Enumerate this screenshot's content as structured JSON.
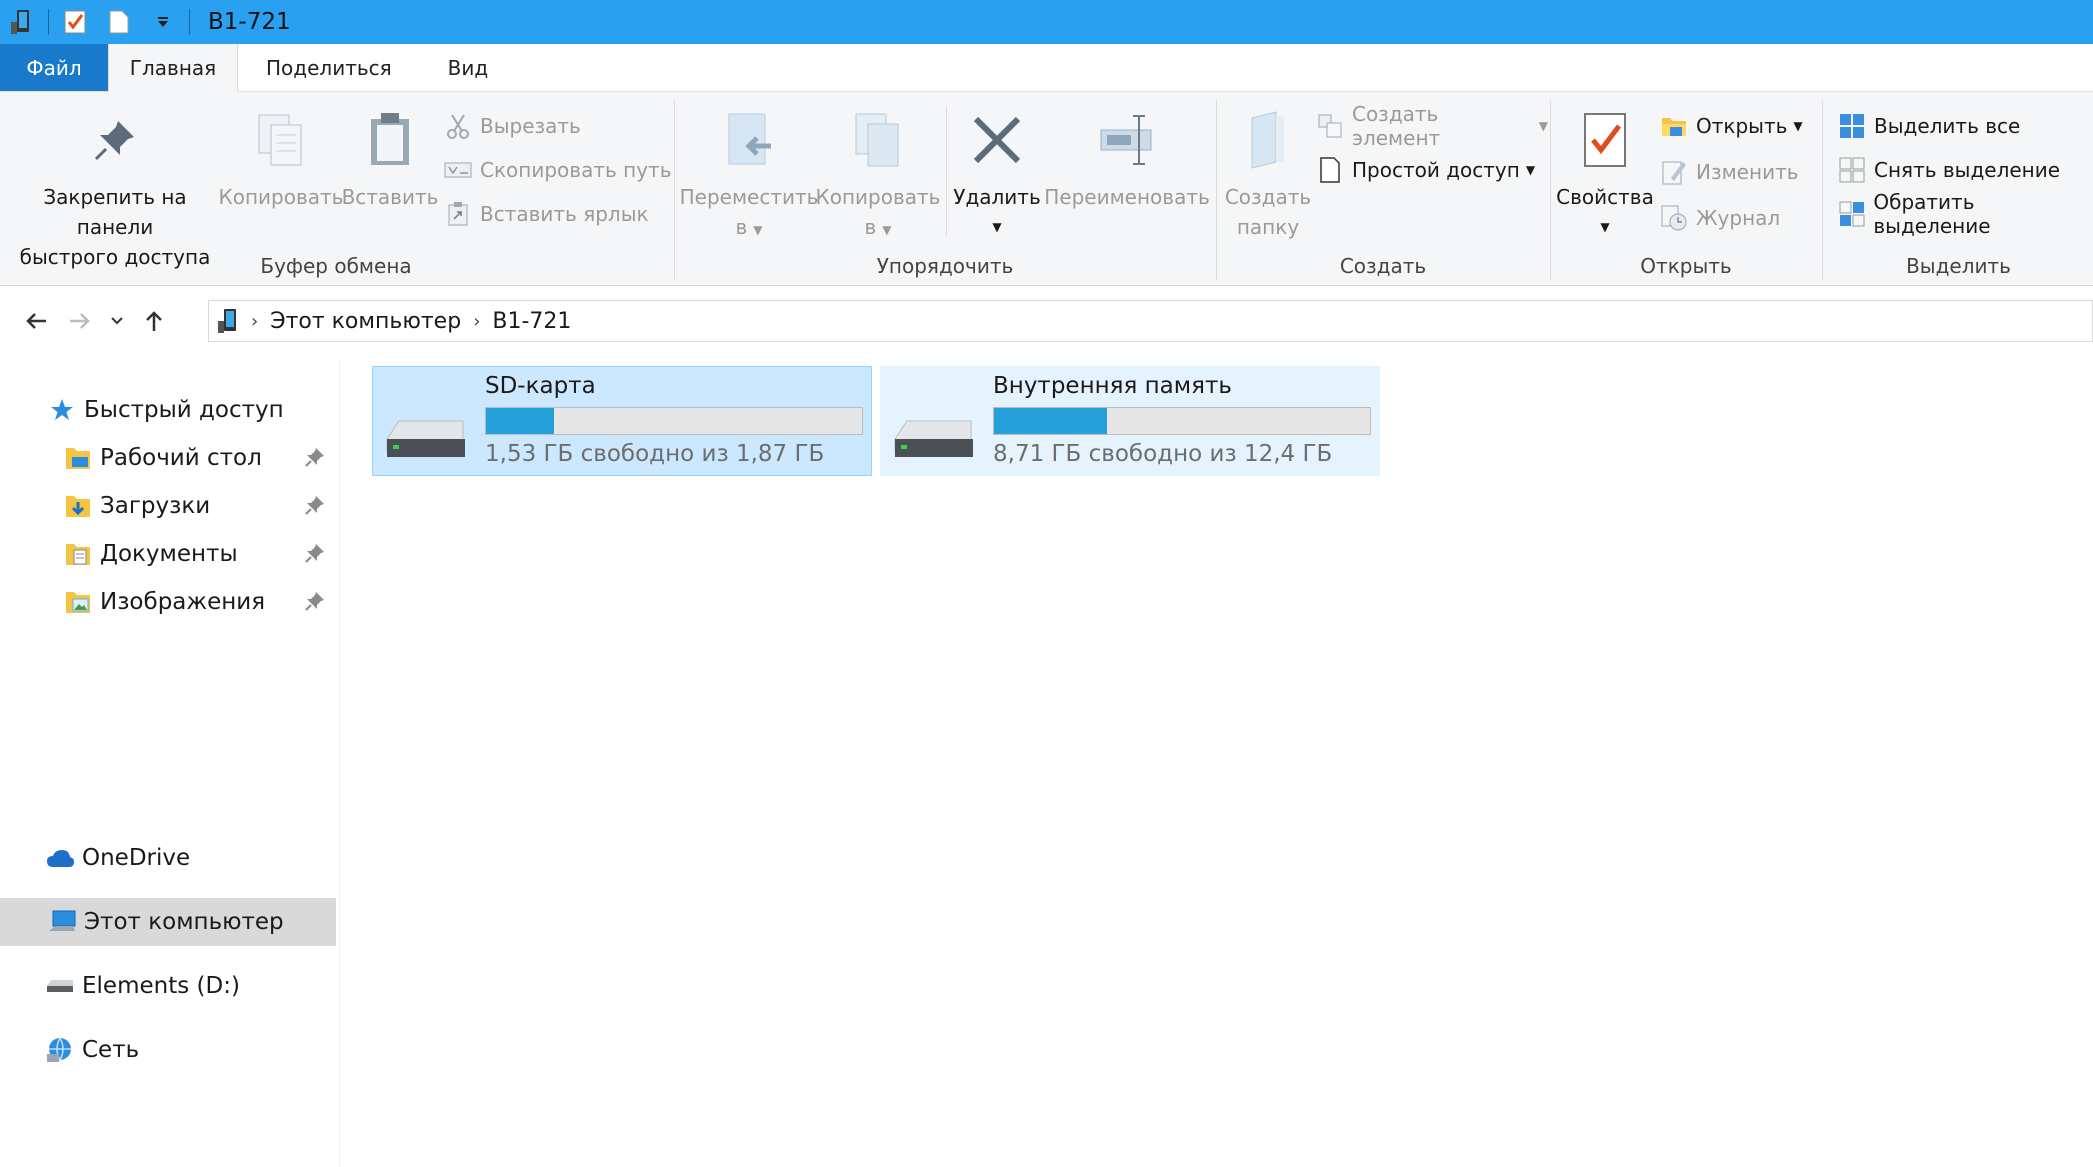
{
  "window": {
    "title": "B1-721"
  },
  "tabs": [
    "Файл",
    "Главная",
    "Поделиться",
    "Вид"
  ],
  "ribbon": {
    "clipboard": {
      "label": "Буфер обмена",
      "pin_line1": "Закрепить на панели",
      "pin_line2": "быстрого доступа",
      "copy": "Копировать",
      "paste": "Вставить",
      "cut": "Вырезать",
      "copy_path": "Скопировать путь",
      "paste_shortcut": "Вставить ярлык"
    },
    "organize": {
      "label": "Упорядочить",
      "move_line1": "Переместить",
      "move_line2": "в",
      "copy_line1": "Копировать",
      "copy_line2": "в",
      "delete": "Удалить",
      "rename": "Переименовать"
    },
    "create": {
      "label": "Создать",
      "new_folder_line1": "Создать",
      "new_folder_line2": "папку",
      "new_item": "Создать элемент",
      "easy_access": "Простой доступ"
    },
    "open": {
      "label": "Открыть",
      "properties": "Свойства",
      "open": "Открыть",
      "edit": "Изменить",
      "history": "Журнал"
    },
    "select": {
      "label": "Выделить",
      "select_all": "Выделить все",
      "select_none": "Снять выделение",
      "invert": "Обратить выделение"
    }
  },
  "address": {
    "crumbs": [
      "Этот компьютер",
      "B1-721"
    ]
  },
  "nav": {
    "quick_access": "Быстрый доступ",
    "quick_items": [
      "Рабочий стол",
      "Загрузки",
      "Документы",
      "Изображения"
    ],
    "onedrive": "OneDrive",
    "this_pc": "Этот компьютер",
    "elements": "Elements (D:)",
    "network": "Сеть"
  },
  "drives": [
    {
      "name": "SD-карта",
      "free_text": "1,53 ГБ свободно из 1,87 ГБ",
      "used_fraction": 0.18
    },
    {
      "name": "Внутренняя память",
      "free_text": "8,71 ГБ свободно из 12,4 ГБ",
      "used_fraction": 0.3
    }
  ],
  "colors": {
    "titlebar": "#2aa1f0",
    "file_tab": "#1979ca",
    "bar_fill": "#26a0da",
    "selected_tile": "#cce8ff"
  }
}
